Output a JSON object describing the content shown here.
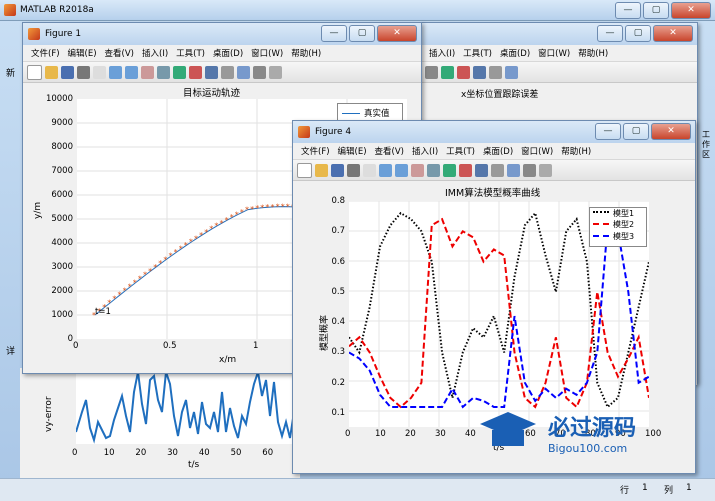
{
  "matlab": {
    "title": "MATLAB R2018a",
    "win_min": "—",
    "win_max": "▢",
    "win_close": "✕",
    "left_label_new": "新",
    "left_label_detail": "详",
    "right_label_workspace": "工作区",
    "status": {
      "row_label": "行",
      "row_value": "1",
      "col_label": "列",
      "col_value": "1"
    }
  },
  "figure1": {
    "title": "Figure 1",
    "menu": [
      "文件(F)",
      "编辑(E)",
      "查看(V)",
      "插入(I)",
      "工具(T)",
      "桌面(D)",
      "窗口(W)",
      "帮助(H)"
    ],
    "axes_title": "目标运动轨迹",
    "xlabel": "x/m",
    "ylabel": "y/m",
    "legend": "真实值",
    "annotation": "t=1",
    "yticks": [
      "10000",
      "9000",
      "8000",
      "7000",
      "6000",
      "5000",
      "4000",
      "3000",
      "2000",
      "1000",
      "0"
    ],
    "xticks": [
      "0",
      "0.5",
      "1",
      "1.5"
    ]
  },
  "figure4": {
    "title": "Figure 4",
    "menu": [
      "文件(F)",
      "编辑(E)",
      "查看(V)",
      "插入(I)",
      "工具(T)",
      "桌面(D)",
      "窗口(W)",
      "帮助(H)"
    ],
    "axes_title": "IMM算法模型概率曲线",
    "xlabel": "t/s",
    "ylabel": "模型概率",
    "legend": [
      "模型1",
      "模型2",
      "模型3"
    ],
    "yticks": [
      "0.8",
      "0.7",
      "0.6",
      "0.5",
      "0.4",
      "0.3",
      "0.2",
      "0.1"
    ],
    "xticks": [
      "0",
      "10",
      "20",
      "30",
      "40",
      "50",
      "60",
      "70",
      "80",
      "90",
      "100"
    ]
  },
  "bg_figure": {
    "menu": [
      "插入(I)",
      "工具(T)",
      "桌面(D)",
      "窗口(W)",
      "帮助(H)"
    ],
    "axes_title": "x坐标位置跟踪误差",
    "ylabel": "vy-error",
    "xlabel": "t/s",
    "xticks": [
      "0",
      "10",
      "20",
      "30",
      "40",
      "50",
      "60",
      "70"
    ]
  },
  "watermark": {
    "text": "必过源码",
    "url": "Bigou100.com"
  }
}
